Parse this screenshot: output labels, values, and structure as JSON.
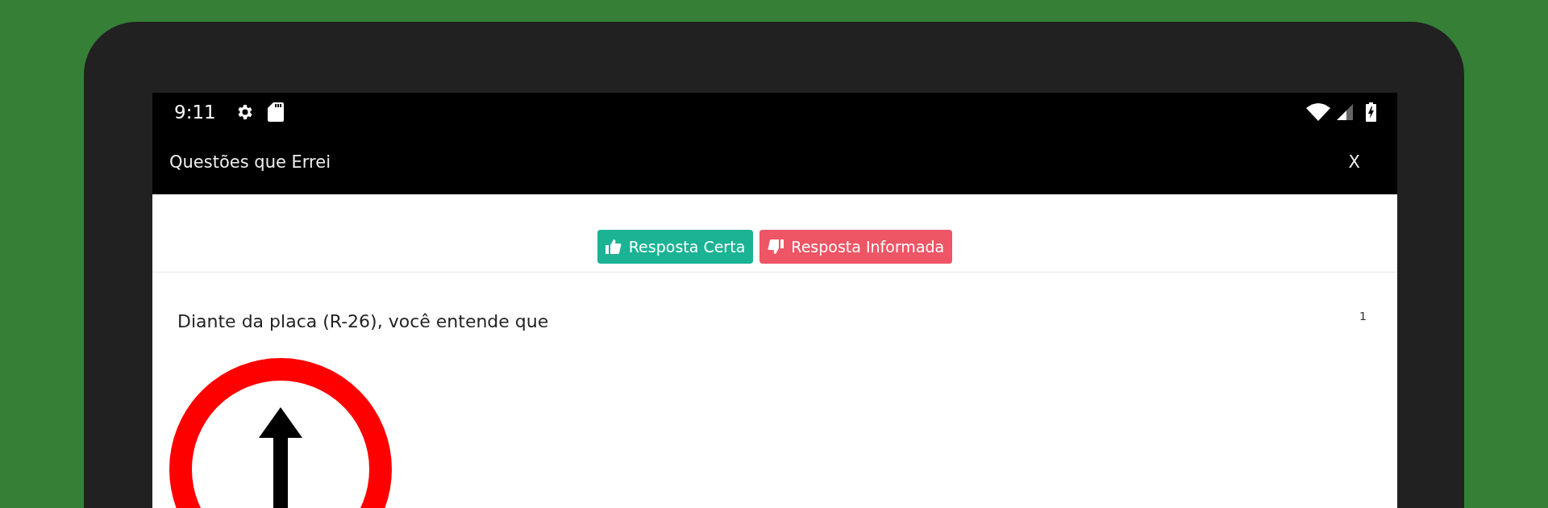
{
  "status_bar": {
    "time": "9:11"
  },
  "toolbar": {
    "title": "Questões que Errei",
    "close": "X"
  },
  "legend": [
    {
      "kind": "correct",
      "label": "Resposta Certa"
    },
    {
      "kind": "informed",
      "label": "Resposta Informada"
    }
  ],
  "question": {
    "text": "Diante da placa (R-26), você entende que",
    "number": "1"
  }
}
